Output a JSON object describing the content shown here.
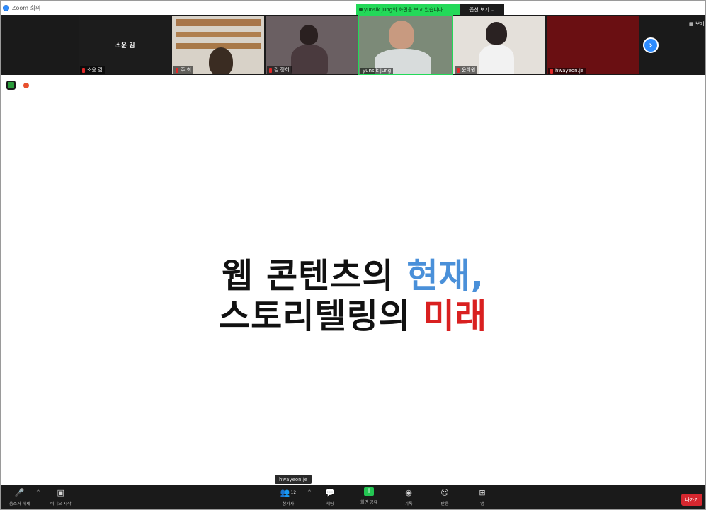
{
  "window": {
    "title": "Zoom 회의"
  },
  "banner": {
    "share_notice": "yunsik jung의 화면을 보고 있습니다",
    "view_options": "옵션 보기 ⌄"
  },
  "gallery_toggle": "보기",
  "participants": [
    {
      "name": "소윤 김",
      "video": false,
      "muted": true,
      "center_label": "소윤 김"
    },
    {
      "name": "주 최",
      "video": true,
      "muted": true
    },
    {
      "name": "김 정희",
      "video": true,
      "muted": true
    },
    {
      "name": "yunsik jung",
      "video": true,
      "muted": false
    },
    {
      "name": "윤희원",
      "video": true,
      "muted": true
    },
    {
      "name": "hwayeon.je",
      "video": false,
      "muted": true
    }
  ],
  "slide": {
    "line1_black": "웹 콘텐츠의 ",
    "line1_blue": "현재,",
    "line2_black": "스토리텔링의 ",
    "line2_red": "미래"
  },
  "speaker_tag": "hwayeon.je",
  "toolbar": {
    "unmute": "음소거 해제",
    "start_video": "비디오 시작",
    "participants": "참가자",
    "participants_count": "12",
    "chat": "채팅",
    "share_screen": "화면 공유",
    "record": "기록",
    "reactions": "반응",
    "apps": "앱",
    "leave": "나가기"
  },
  "colors": {
    "share_green": "#23d959",
    "zoom_blue": "#2d8cff",
    "leave_red": "#d6272f",
    "slide_blue": "#4a90d9",
    "slide_red": "#d92020"
  }
}
